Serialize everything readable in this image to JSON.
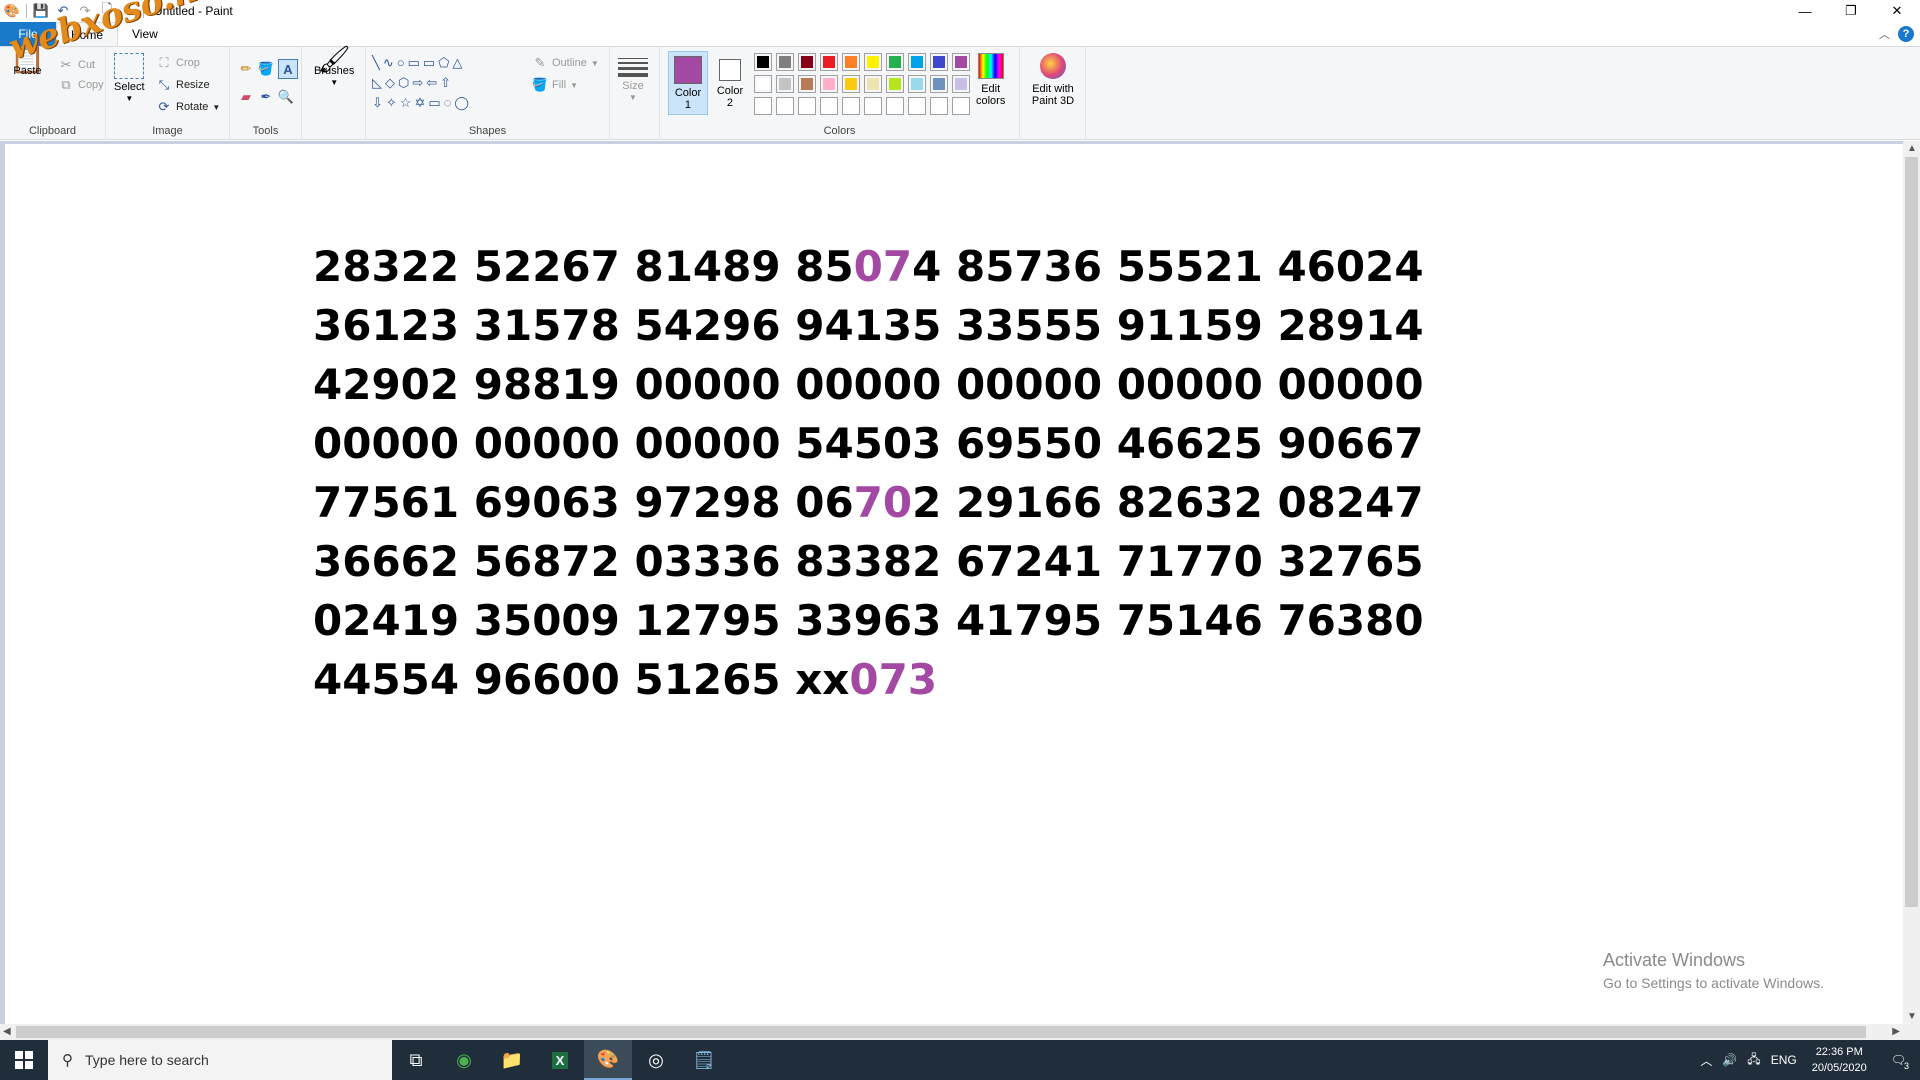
{
  "window": {
    "title": "Untitled - Paint",
    "controls": {
      "minimize": "—",
      "maximize": "❐",
      "close": "✕"
    }
  },
  "tabs": {
    "file": "File",
    "home": "Home",
    "view": "View"
  },
  "ribbon": {
    "clipboard": {
      "label": "Clipboard",
      "paste": "Paste",
      "cut": "Cut",
      "copy": "Copy"
    },
    "image": {
      "label": "Image",
      "select": "Select",
      "crop": "Crop",
      "resize": "Resize",
      "rotate": "Rotate"
    },
    "tools": {
      "label": "Tools"
    },
    "brushes": {
      "label": "Brushes"
    },
    "shapes": {
      "label": "Shapes",
      "outline": "Outline",
      "fill": "Fill"
    },
    "size": {
      "label": "Size"
    },
    "colors": {
      "label": "Colors",
      "color1": "Color\n1",
      "color1_value": "#a349a4",
      "color2": "Color\n2",
      "color2_value": "#ffffff",
      "edit": "Edit\ncolors",
      "palette_row1": [
        "#000000",
        "#7f7f7f",
        "#880015",
        "#ed1c24",
        "#ff7f27",
        "#fff200",
        "#22b14c",
        "#00a2e8",
        "#3f48cc",
        "#a349a4"
      ],
      "palette_row2": [
        "#ffffff",
        "#c3c3c3",
        "#b97a57",
        "#ffaec9",
        "#ffc90e",
        "#efe4b0",
        "#b5e61d",
        "#99d9ea",
        "#7092be",
        "#c8bfe7"
      ]
    },
    "paint3d": {
      "label": "Edit with\nPaint 3D"
    }
  },
  "canvas": {
    "lines": [
      [
        "28322 52267 81489 85",
        "07",
        "4 85736 55521 46024"
      ],
      [
        "36123 31578 54296 94135 33555 91159 28914",
        "",
        ""
      ],
      [
        "42902 98819 00000 00000 00000 00000 00000",
        "",
        ""
      ],
      [
        "00000 00000 00000 54503 69550 46625 90667",
        "",
        ""
      ],
      [
        "77561 69063 97298 06",
        "70",
        "2 29166 82632 08247"
      ],
      [
        "36662 56872 03336 83382 67241 71770 32765",
        "",
        ""
      ],
      [
        "02419 35009 12795 33963 41795 75146 76380",
        "",
        ""
      ],
      [
        "44554 96600 51265 xx",
        "073",
        ""
      ]
    ],
    "highlight_color": "#a349a4"
  },
  "activate": {
    "title": "Activate Windows",
    "subtitle": "Go to Settings to activate Windows."
  },
  "watermark": "webxoso.net",
  "taskbar": {
    "search_placeholder": "Type here to search",
    "lang": "ENG",
    "time": "22:36 PM",
    "date": "20/05/2020",
    "notifications": "3"
  }
}
